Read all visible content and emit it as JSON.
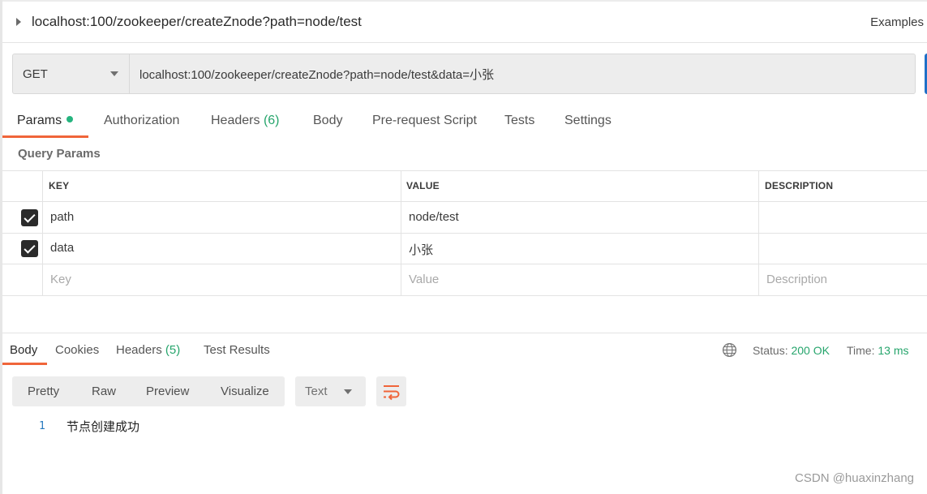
{
  "request": {
    "title": "localhost:100/zookeeper/createZnode?path=node/test",
    "examples_label": "Examples",
    "method": "GET",
    "url": "localhost:100/zookeeper/createZnode?path=node/test&data=小张"
  },
  "request_tabs": {
    "params": "Params",
    "authorization": "Authorization",
    "headers": "Headers",
    "headers_count": "(6)",
    "body": "Body",
    "pre_request_script": "Pre-request Script",
    "tests": "Tests",
    "settings": "Settings"
  },
  "query_params": {
    "label": "Query Params",
    "columns": {
      "key": "KEY",
      "value": "VALUE",
      "description": "DESCRIPTION"
    },
    "rows": [
      {
        "checked": true,
        "key": "path",
        "value": "node/test",
        "description": ""
      },
      {
        "checked": true,
        "key": "data",
        "value": "小张",
        "description": ""
      }
    ],
    "placeholders": {
      "key": "Key",
      "value": "Value",
      "description": "Description"
    }
  },
  "response": {
    "tabs": {
      "body": "Body",
      "cookies": "Cookies",
      "headers": "Headers",
      "headers_count": "(5)",
      "test_results": "Test Results"
    },
    "status_label": "Status:",
    "status_value": "200 OK",
    "time_label": "Time:",
    "time_value": "13 ms",
    "view_modes": {
      "pretty": "Pretty",
      "raw": "Raw",
      "preview": "Preview",
      "visualize": "Visualize"
    },
    "format": "Text",
    "body_lines": [
      {
        "number": "1",
        "text": "节点创建成功"
      }
    ]
  },
  "watermark": "CSDN @huaxinzhang",
  "colors": {
    "accent_orange": "#f0653a",
    "success_green": "#26a56c",
    "send_blue": "#1f70c7"
  }
}
